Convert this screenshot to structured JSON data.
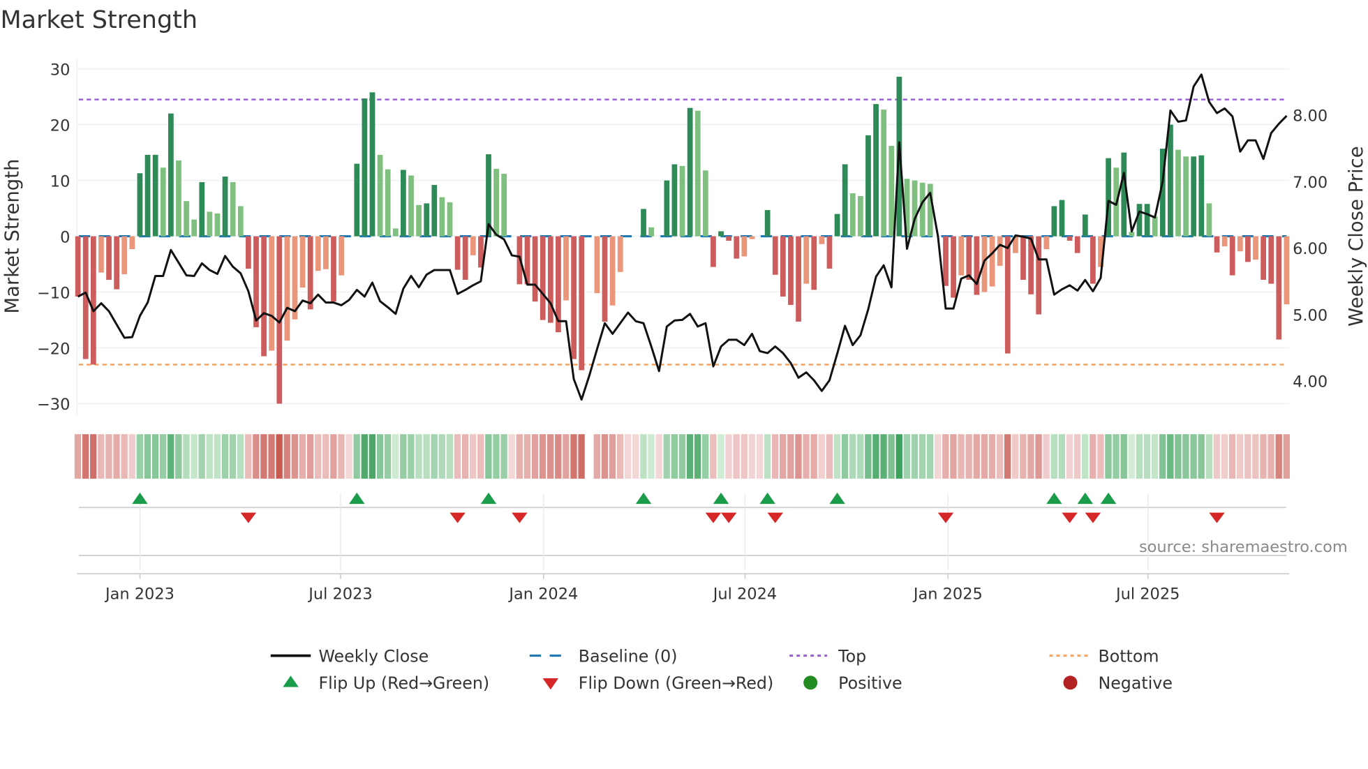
{
  "title": "Market Strength",
  "source": "source: sharemaestro.com",
  "colors": {
    "pos_strong": "#2e8b57",
    "pos_weak": "#7fbf7f",
    "neg_strong": "#cd5c5c",
    "neg_weak": "#e9967a",
    "baseline": "#1f77b4",
    "top": "#9b5fd6",
    "bottom": "#f4a460",
    "flip_up": "#1a9c4a",
    "flip_down": "#d62728",
    "positive": "#228b22",
    "negative": "#b22222",
    "line": "#111111"
  },
  "chart_data": {
    "type": "bar+line",
    "title": "Market Strength",
    "ylabel": "Market Strength",
    "y2label": "Weekly Close Price",
    "ylim": [
      -30,
      30
    ],
    "y2lim": [
      4.0,
      8.0
    ],
    "yticks": [
      "30",
      "20",
      "10",
      "0",
      "−10",
      "−20",
      "−30"
    ],
    "ytick_values": [
      30,
      20,
      10,
      0,
      -10,
      -20,
      -30
    ],
    "y2ticks": [
      "8.00",
      "7.00",
      "6.00",
      "5.00",
      "4.00"
    ],
    "y2tick_values": [
      8,
      7,
      6,
      5,
      4
    ],
    "top_level": 24.5,
    "bottom_level": -23,
    "baseline": 0,
    "x_unit": "week index (weekly, from Nov 2022 to Nov 2025)",
    "xticks": [
      {
        "label": "Jan 2023",
        "week": 8
      },
      {
        "label": "Jul 2023",
        "week": 33.9
      },
      {
        "label": "Jan 2024",
        "week": 60.1
      },
      {
        "label": "Jul 2024",
        "week": 86.1
      },
      {
        "label": "Jan 2025",
        "week": 112.3
      },
      {
        "label": "Jul 2025",
        "week": 138.1
      }
    ],
    "strength": [
      -10.8,
      -22,
      -23,
      -6.5,
      -7.8,
      -9.5,
      -6.8,
      -2.3,
      11.3,
      14.6,
      14.6,
      12.3,
      22,
      13.6,
      6.3,
      3,
      9.7,
      4.4,
      4.1,
      10.7,
      9.7,
      5.4,
      -5.8,
      -16.3,
      -21.5,
      -20.5,
      -30,
      -18.7,
      -14.9,
      -9.2,
      -13.1,
      -6.2,
      -5.9,
      -11.7,
      -7,
      0,
      13,
      24.7,
      25.8,
      14.6,
      12,
      1.4,
      11.9,
      10.9,
      5.6,
      5.9,
      9.2,
      7,
      6.1,
      -6,
      -7.8,
      -3.4,
      -5.6,
      14.7,
      12.1,
      11.2,
      0,
      -8.6,
      -8.6,
      -11.7,
      -15,
      -15.5,
      -17.2,
      -11.5,
      -22,
      -24,
      null,
      -10.2,
      -15.3,
      -12.4,
      -6.4,
      0,
      0,
      4.9,
      1.6,
      0,
      10,
      12.9,
      12.6,
      23,
      22.5,
      11.8,
      -5.5,
      0.9,
      -0.8,
      -4,
      -3.6,
      -0.5,
      0,
      4.7,
      -6.9,
      -10.8,
      -12.3,
      -15.3,
      -8.5,
      -9.6,
      -1.4,
      -5.8,
      4,
      12.9,
      7.7,
      7.2,
      18.1,
      23.7,
      22.7,
      16.2,
      28.6,
      10.3,
      10,
      9.6,
      9.4,
      0,
      -8.9,
      -11,
      -7,
      -7.8,
      -10.5,
      -10,
      -9,
      -5.3,
      -21,
      -3,
      -7.8,
      -10.4,
      -14,
      -2.3,
      5.4,
      6.5,
      -0.8,
      -3,
      3.9,
      -8.5,
      -5.5,
      14,
      12.3,
      15,
      0.8,
      5.8,
      5.8,
      3.5,
      15.7,
      20,
      15.5,
      14.3,
      14.3,
      14.5,
      5.9,
      -2.9,
      -1.8,
      -7,
      -2.7,
      -4.6,
      -4.2,
      -7.8,
      -8.5,
      -18.5,
      -12.2
    ],
    "weekly_close": [
      5.27,
      5.33,
      5.05,
      5.17,
      5.05,
      4.85,
      4.65,
      4.66,
      4.98,
      5.18,
      5.58,
      5.58,
      5.97,
      5.78,
      5.59,
      5.58,
      5.77,
      5.67,
      5.61,
      5.88,
      5.72,
      5.62,
      5.35,
      4.91,
      5.02,
      4.98,
      4.88,
      5.1,
      5.05,
      5.21,
      5.17,
      5.3,
      5.18,
      5.18,
      5.14,
      5.22,
      5.37,
      5.27,
      5.48,
      5.2,
      5.11,
      5.01,
      5.39,
      5.58,
      5.41,
      5.6,
      5.67,
      5.67,
      5.67,
      5.31,
      5.37,
      5.44,
      5.5,
      6.36,
      6.2,
      6.13,
      5.89,
      5.87,
      5.45,
      5.45,
      5.31,
      5.17,
      4.9,
      4.9,
      4.03,
      3.72,
      4.08,
      4.48,
      4.87,
      4.71,
      4.87,
      5.03,
      4.9,
      4.87,
      4.52,
      4.15,
      4.82,
      4.91,
      4.92,
      5.01,
      4.82,
      4.87,
      4.22,
      4.52,
      4.62,
      4.62,
      4.54,
      4.71,
      4.45,
      4.42,
      4.52,
      4.42,
      4.27,
      4.05,
      4.13,
      4.01,
      3.85,
      4.01,
      4.41,
      4.83,
      4.54,
      4.69,
      5.08,
      5.57,
      5.74,
      5.41,
      7.59,
      5.99,
      6.44,
      6.69,
      6.83,
      6.18,
      5.09,
      5.09,
      5.54,
      5.59,
      5.46,
      5.81,
      5.92,
      6.05,
      6.0,
      6.19,
      6.17,
      6.14,
      5.83,
      5.83,
      5.3,
      5.38,
      5.44,
      5.36,
      5.52,
      5.35,
      5.55,
      6.71,
      6.65,
      7.13,
      6.25,
      6.55,
      6.51,
      6.46,
      7.0,
      8.07,
      7.9,
      7.92,
      8.43,
      8.61,
      8.2,
      8.03,
      8.1,
      7.98,
      7.45,
      7.62,
      7.62,
      7.34,
      7.73,
      7.87,
      7.99
    ],
    "legend_position": "bottom-center",
    "legend": {
      "weekly_close": "Weekly Close",
      "baseline": "Baseline (0)",
      "top": "Top",
      "bottom": "Bottom",
      "flip_up": "Flip Up (Red→Green)",
      "flip_down": "Flip Down (Green→Red)",
      "positive": "Positive",
      "negative": "Negative"
    }
  }
}
